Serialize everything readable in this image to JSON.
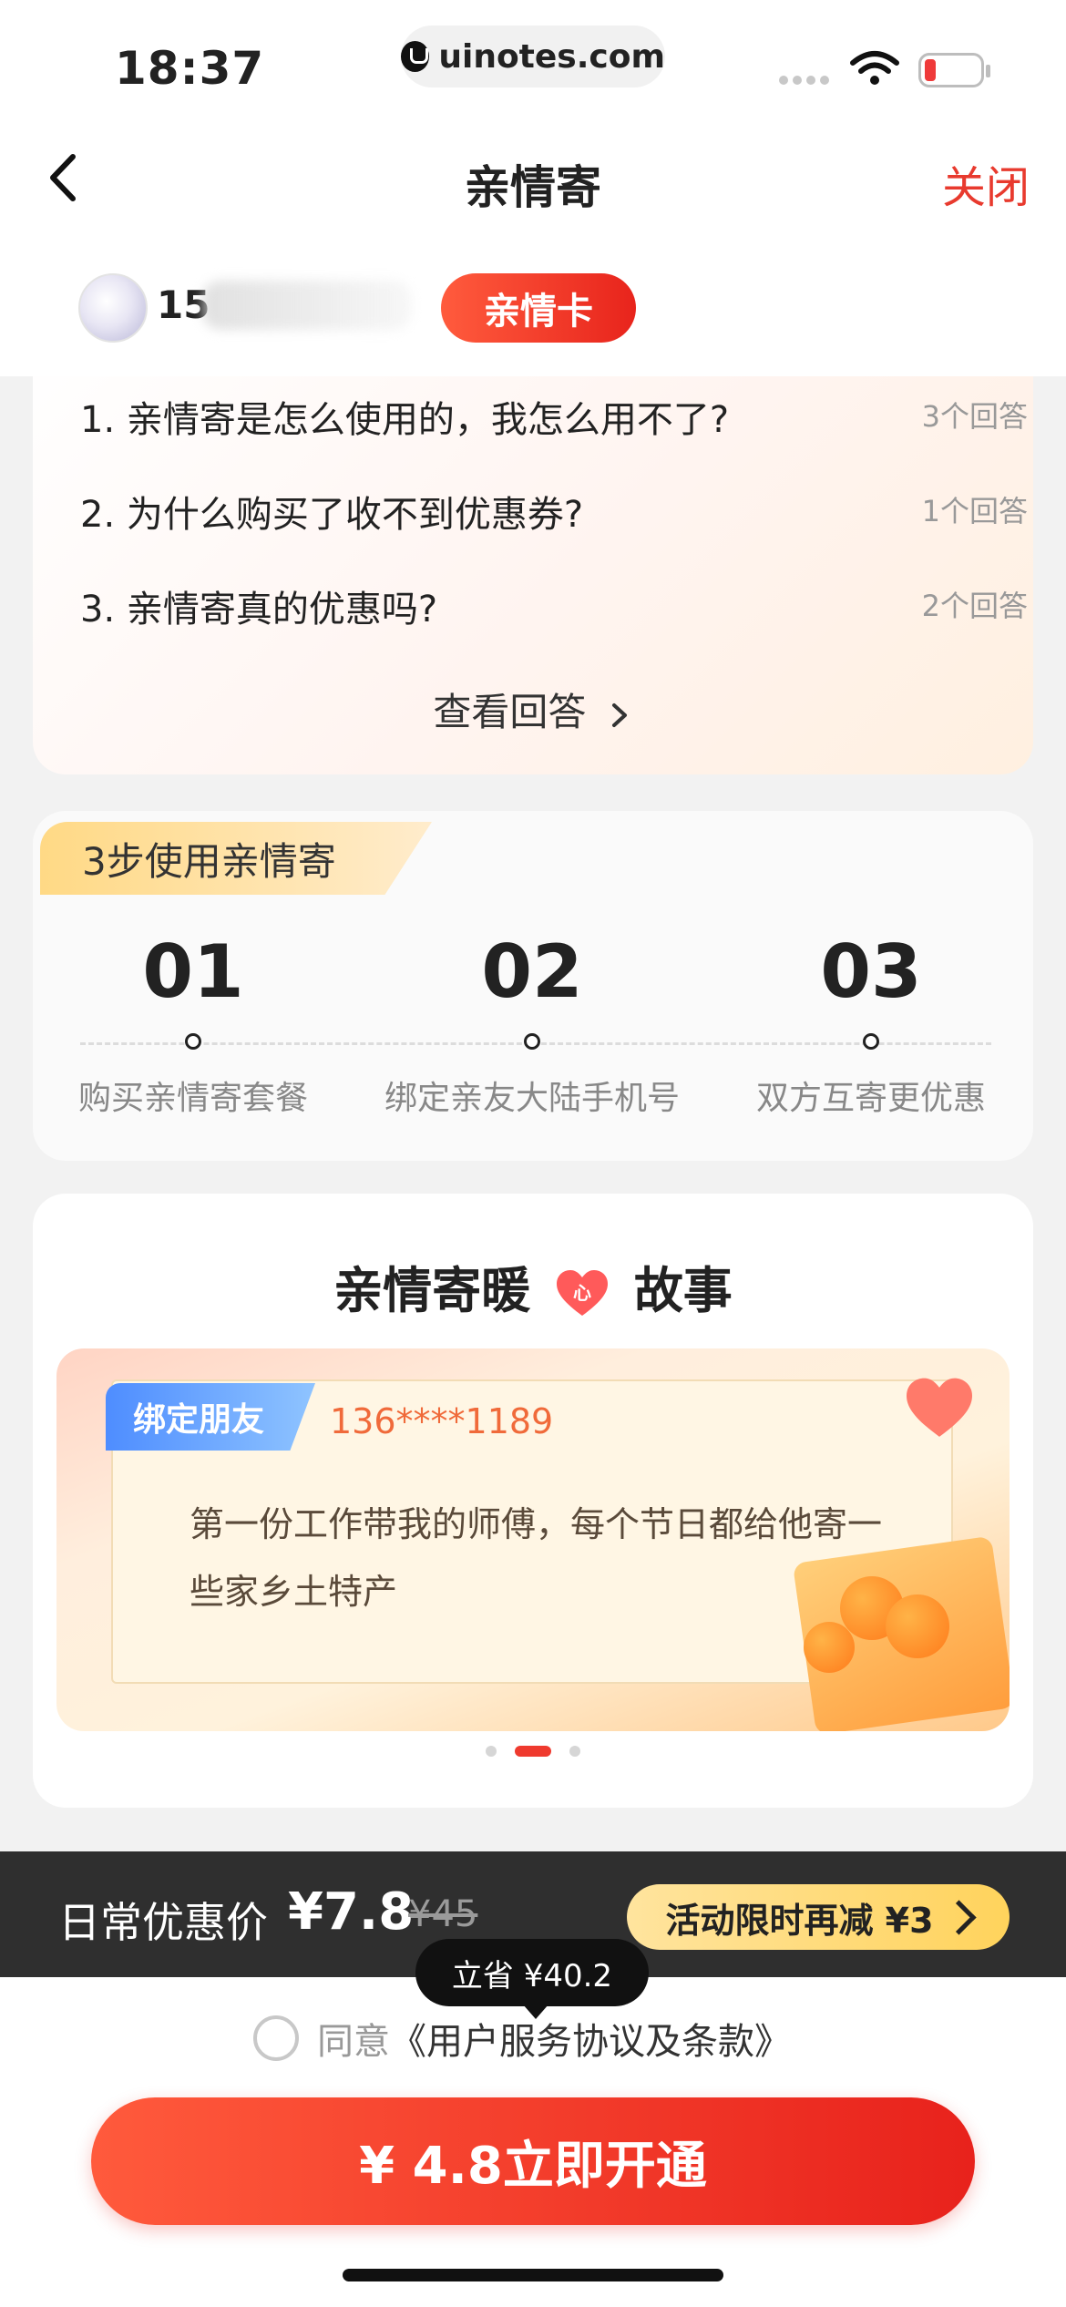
{
  "status": {
    "time": "18:37",
    "url": "uinotes.com"
  },
  "nav": {
    "title": "亲情寄",
    "close_label": "关闭"
  },
  "user": {
    "phone_prefix": "15",
    "badge": "亲情卡"
  },
  "qa": {
    "items": [
      {
        "question": "1. 亲情寄是怎么使用的，我怎么用不了?",
        "answers": "3个回答"
      },
      {
        "question": "2. 为什么购买了收不到优惠券?",
        "answers": "1个回答"
      },
      {
        "question": "3. 亲情寄真的优惠吗?",
        "answers": "2个回答"
      }
    ],
    "more_label": "查看回答"
  },
  "steps": {
    "title": "3步使用亲情寄",
    "items": [
      {
        "num": "01",
        "label": "购买亲情寄套餐"
      },
      {
        "num": "02",
        "label": "绑定亲友大陆手机号"
      },
      {
        "num": "03",
        "label": "双方互寄更优惠"
      }
    ]
  },
  "story": {
    "title_left": "亲情寄暖",
    "title_heart": "心",
    "title_right": "故事",
    "tag": "绑定朋友",
    "phone": "136****1189",
    "text": "第一份工作带我的师傅，每个节日都给他寄一些家乡土特产",
    "page_index": 2,
    "page_total": 3
  },
  "price": {
    "label": "日常优惠价",
    "now": "¥7.8",
    "old": "¥45",
    "promo": "活动限时再减 ¥3",
    "save_tip": "立省 ¥40.2"
  },
  "agree": {
    "prefix": "同意",
    "link": "《用户服务协议及条款》"
  },
  "cta": {
    "label": "¥ 4.8立即开通"
  },
  "colors": {
    "accent": "#e8241c",
    "promo": "#ffd35c",
    "price_bar": "#2f2f2f"
  }
}
